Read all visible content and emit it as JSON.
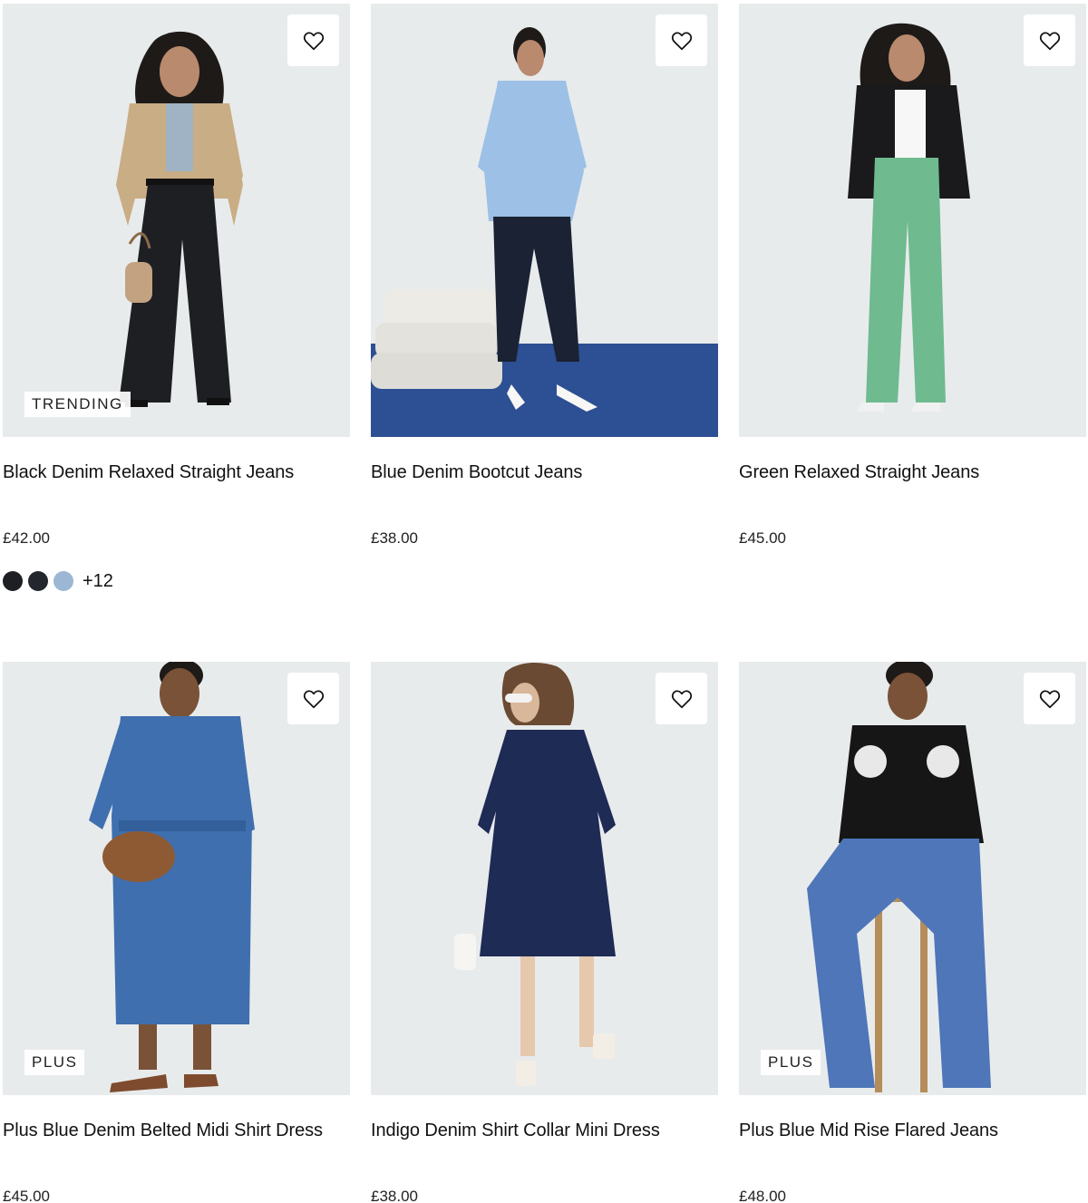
{
  "colors": {
    "image_bg": "#e8ebec",
    "carpet_blue": "#2d4f93",
    "swatch_black": "#1d1f22",
    "swatch_navy": "#23272d",
    "swatch_lightblue": "#9bb7d3"
  },
  "icons": {
    "wishlist": "heart-outline-icon"
  },
  "products": [
    {
      "title": "Black Denim Relaxed Straight Jeans",
      "price": "£42.00",
      "badge": "TRENDING",
      "swatches": [
        "#1d1f22",
        "#23272d",
        "#9bb7d3"
      ],
      "more_colors": "+12"
    },
    {
      "title": "Blue Denim Bootcut Jeans",
      "price": "£38.00",
      "badge": ""
    },
    {
      "title": "Green Relaxed Straight Jeans",
      "price": "£45.00",
      "badge": ""
    },
    {
      "title": "Plus Blue Denim Belted Midi Shirt Dress",
      "price": "£45.00",
      "badge": "PLUS"
    },
    {
      "title": "Indigo Denim Shirt Collar Mini Dress",
      "price": "£38.00",
      "badge": ""
    },
    {
      "title": "Plus Blue Mid Rise Flared Jeans",
      "price": "£48.00",
      "badge": "PLUS"
    }
  ]
}
